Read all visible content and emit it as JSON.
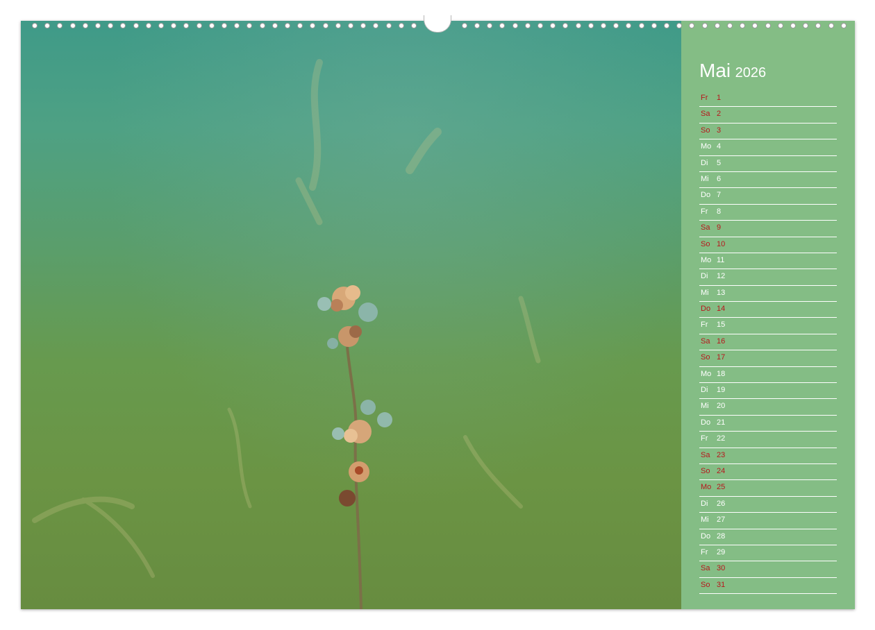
{
  "calendar": {
    "month": "Mai",
    "year": "2026",
    "colors": {
      "panel": "#84bd85",
      "weekend": "#b8161c",
      "text": "#ffffff"
    },
    "days": [
      {
        "abbr": "Fr",
        "num": "1",
        "red": true
      },
      {
        "abbr": "Sa",
        "num": "2",
        "red": true
      },
      {
        "abbr": "So",
        "num": "3",
        "red": true
      },
      {
        "abbr": "Mo",
        "num": "4",
        "red": false
      },
      {
        "abbr": "Di",
        "num": "5",
        "red": false
      },
      {
        "abbr": "Mi",
        "num": "6",
        "red": false
      },
      {
        "abbr": "Do",
        "num": "7",
        "red": false
      },
      {
        "abbr": "Fr",
        "num": "8",
        "red": false
      },
      {
        "abbr": "Sa",
        "num": "9",
        "red": true
      },
      {
        "abbr": "So",
        "num": "10",
        "red": true
      },
      {
        "abbr": "Mo",
        "num": "11",
        "red": false
      },
      {
        "abbr": "Di",
        "num": "12",
        "red": false
      },
      {
        "abbr": "Mi",
        "num": "13",
        "red": false
      },
      {
        "abbr": "Do",
        "num": "14",
        "red": true
      },
      {
        "abbr": "Fr",
        "num": "15",
        "red": false
      },
      {
        "abbr": "Sa",
        "num": "16",
        "red": true
      },
      {
        "abbr": "So",
        "num": "17",
        "red": true
      },
      {
        "abbr": "Mo",
        "num": "18",
        "red": false
      },
      {
        "abbr": "Di",
        "num": "19",
        "red": false
      },
      {
        "abbr": "Mi",
        "num": "20",
        "red": false
      },
      {
        "abbr": "Do",
        "num": "21",
        "red": false
      },
      {
        "abbr": "Fr",
        "num": "22",
        "red": false
      },
      {
        "abbr": "Sa",
        "num": "23",
        "red": true
      },
      {
        "abbr": "So",
        "num": "24",
        "red": true
      },
      {
        "abbr": "Mo",
        "num": "25",
        "red": true
      },
      {
        "abbr": "Di",
        "num": "26",
        "red": false
      },
      {
        "abbr": "Mi",
        "num": "27",
        "red": false
      },
      {
        "abbr": "Do",
        "num": "28",
        "red": false
      },
      {
        "abbr": "Fr",
        "num": "29",
        "red": false
      },
      {
        "abbr": "Sa",
        "num": "30",
        "red": true
      },
      {
        "abbr": "So",
        "num": "31",
        "red": true
      }
    ]
  }
}
